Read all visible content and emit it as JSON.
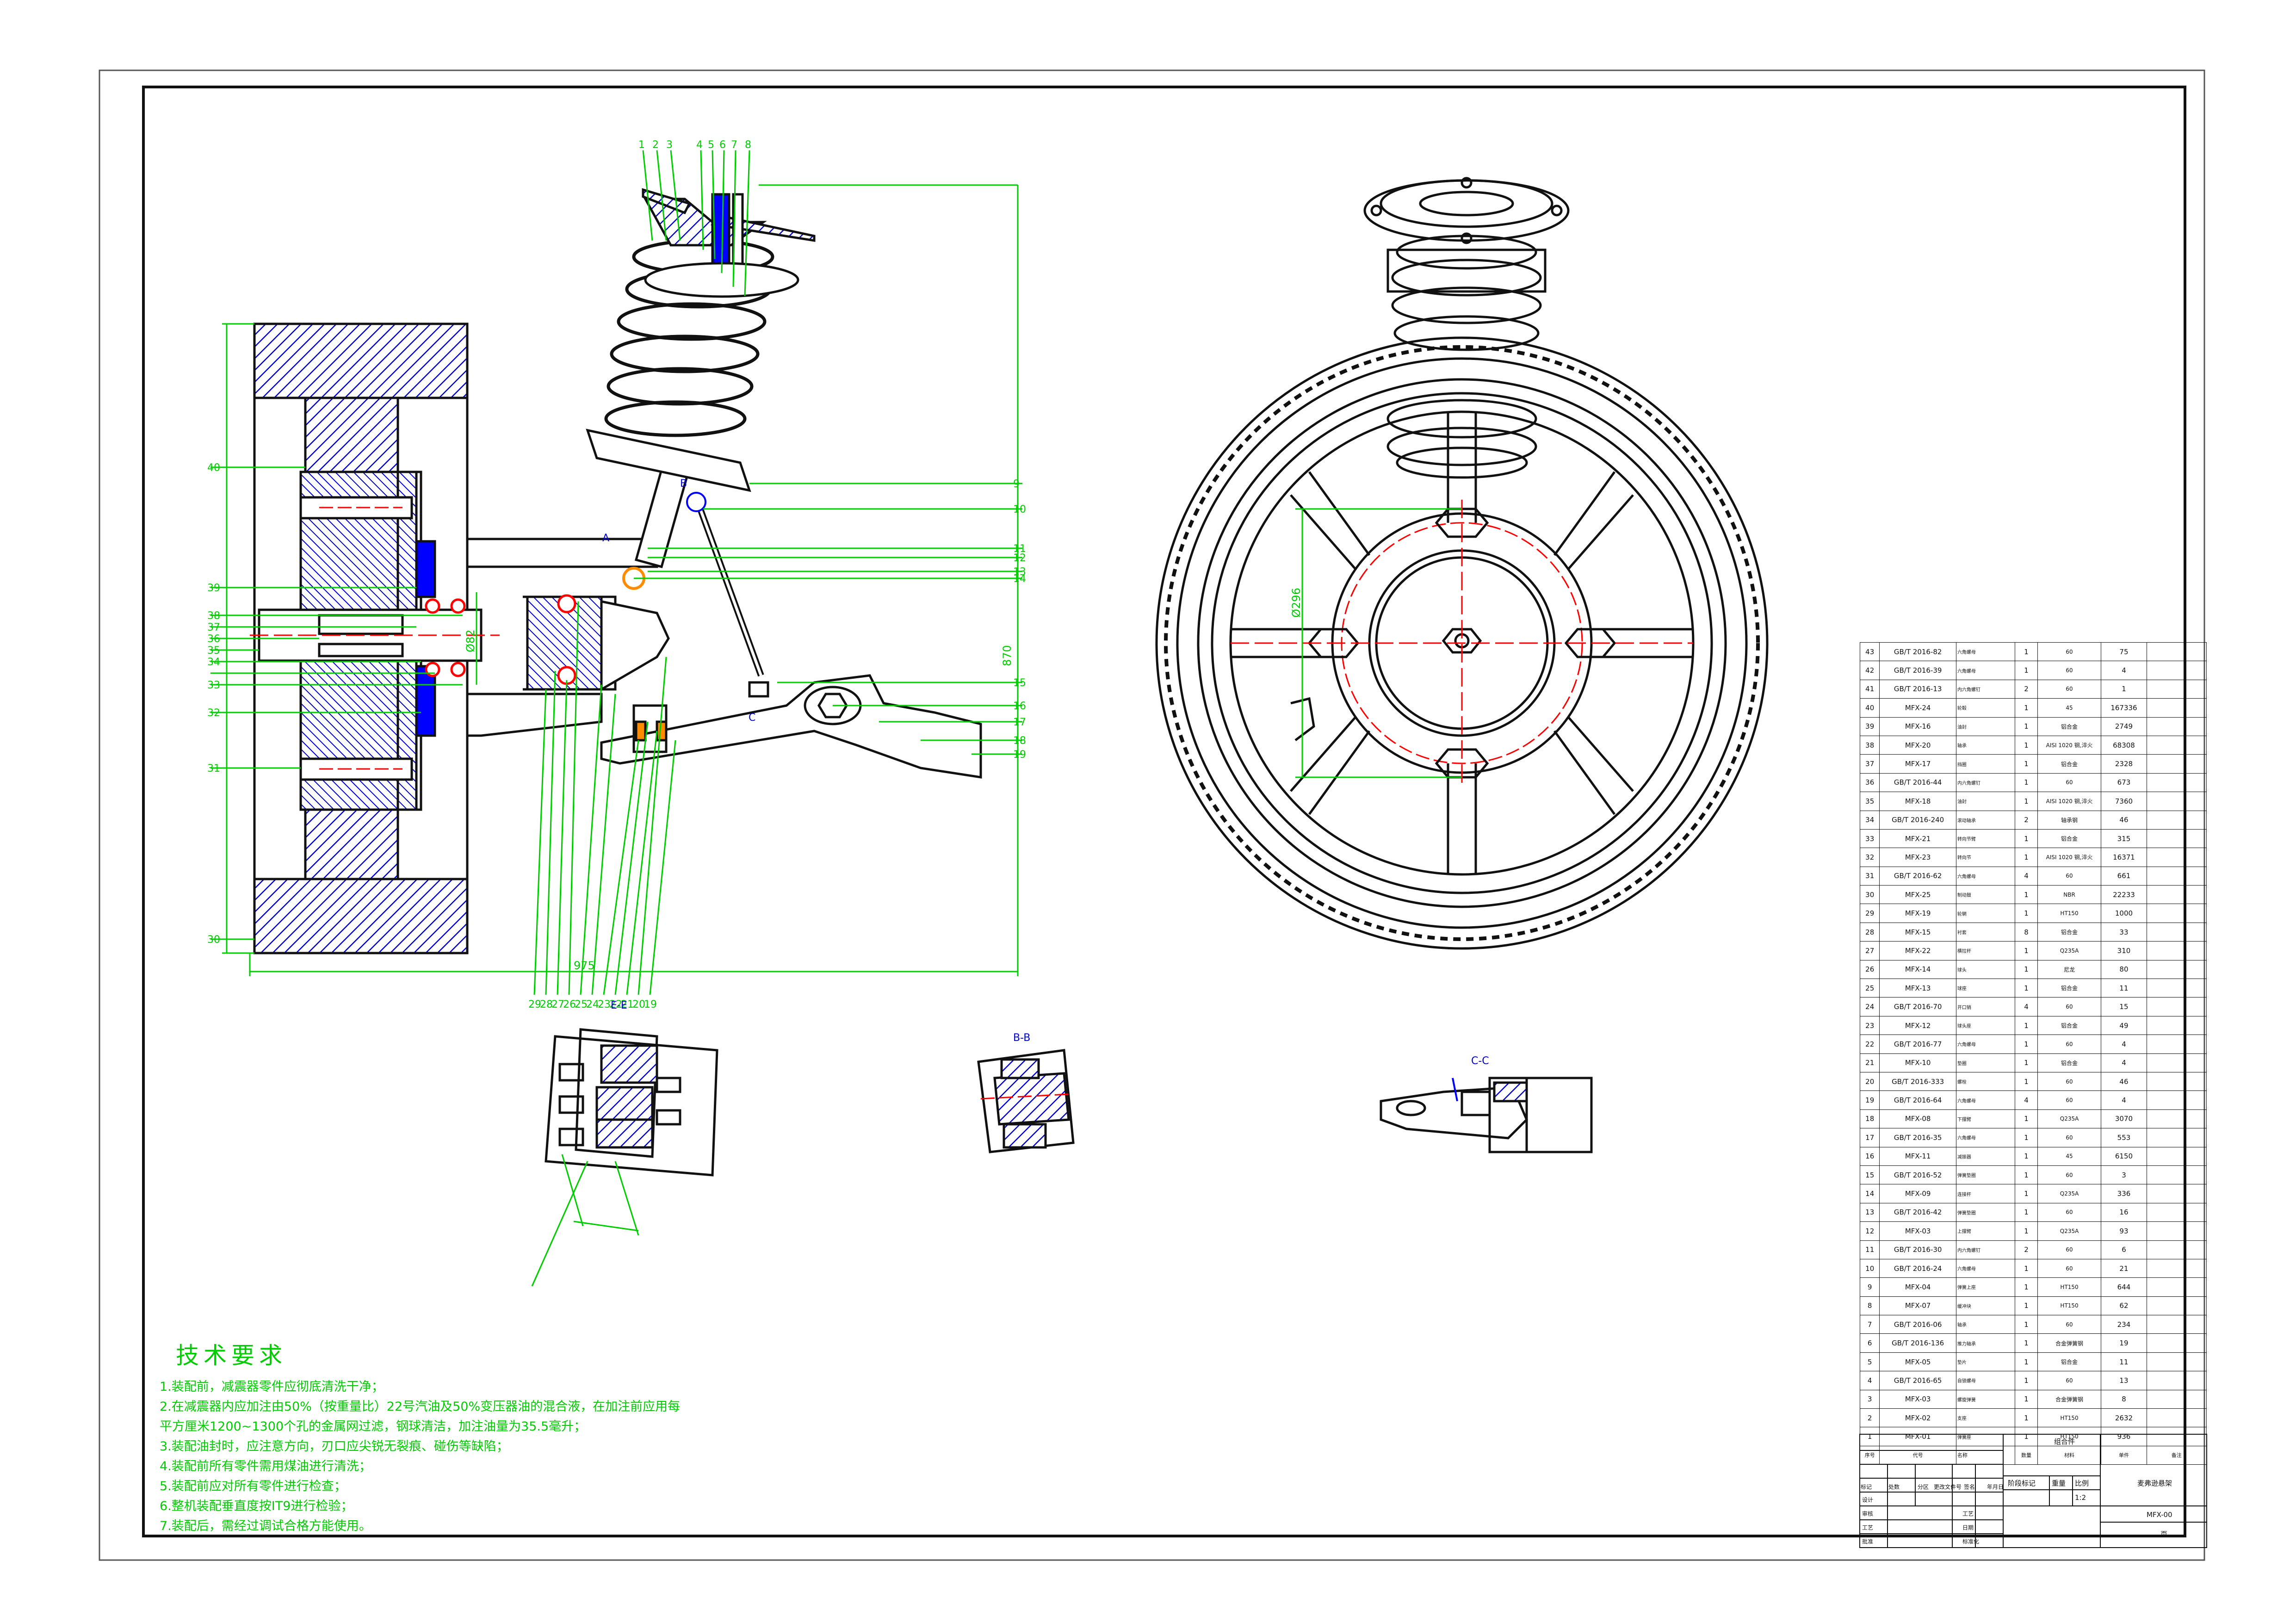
{
  "colors": {
    "outline": "#111111",
    "hatch": "#0000cc",
    "dimension": "#00cc00",
    "centerline": "#ff0000",
    "seal": "#0000ff",
    "weld": "#ff8c00"
  },
  "balloons_top": [
    "1",
    "2",
    "3",
    "4",
    "5",
    "6",
    "7",
    "8"
  ],
  "balloons_left": [
    "40",
    "39",
    "38",
    "37",
    "36",
    "35",
    "34",
    "33",
    "32",
    "31",
    "30"
  ],
  "balloons_right": [
    "9",
    "10",
    "11",
    "12",
    "13",
    "14",
    "15",
    "16",
    "17",
    "18",
    "19"
  ],
  "balloons_bottom": [
    "29",
    "28",
    "27",
    "26",
    "25",
    "24",
    "23",
    "22",
    "21",
    "20",
    "19"
  ],
  "view_labels": {
    "a": "A",
    "b": "B",
    "c": "C",
    "section_b": "B-B",
    "section_c": "C-C",
    "section_e": "E-E"
  },
  "dimensions": {
    "width": "975",
    "height": "870",
    "bore": "Ø82",
    "pcd": "Ø296"
  },
  "technical_requirements": {
    "title": "技术要求",
    "lines": [
      "1.装配前，减震器零件应彻底清洗干净；",
      "2.在减震器内应加注由50%（按重量比）22号汽油及50%变压器油的混合液，在加注前应用每",
      "平方厘米1200~1300个孔的金属网过滤，钢球清洁，加注油量为35.5毫升；",
      "3.装配油封时，应注意方向，刃口应尖锐无裂痕、碰伤等缺陷；",
      "4.装配前所有零件需用煤油进行清洗；",
      "5.装配前应对所有零件进行检查；",
      "6.整机装配垂直度按IT9进行检验；",
      "7.装配后，需经过调试合格方能使用。"
    ]
  },
  "bom": {
    "rows": [
      [
        "43",
        "GB/T 2016-82",
        "六角螺母",
        "1",
        "60",
        "75",
        ""
      ],
      [
        "42",
        "GB/T 2016-39",
        "六角螺母",
        "1",
        "60",
        "4",
        ""
      ],
      [
        "41",
        "GB/T 2016-13",
        "内六角螺钉",
        "2",
        "60",
        "1",
        ""
      ],
      [
        "40",
        "MFX-24",
        "轮毂",
        "1",
        "45",
        "167336",
        ""
      ],
      [
        "39",
        "MFX-16",
        "油封",
        "1",
        "铝合金",
        "2749",
        ""
      ],
      [
        "38",
        "MFX-20",
        "轴承",
        "1",
        "AISI 1020 钢,淬火",
        "68308",
        ""
      ],
      [
        "37",
        "MFX-17",
        "挡圈",
        "1",
        "铝合金",
        "2328",
        ""
      ],
      [
        "36",
        "GB/T 2016-44",
        "内六角螺钉",
        "1",
        "60",
        "673",
        ""
      ],
      [
        "35",
        "MFX-18",
        "油封",
        "1",
        "AISI 1020 钢,淬火",
        "7360",
        ""
      ],
      [
        "34",
        "GB/T 2016-240",
        "滚动轴承",
        "2",
        "轴承钢",
        "46",
        ""
      ],
      [
        "33",
        "MFX-21",
        "转向节臂",
        "1",
        "铝合金",
        "315",
        ""
      ],
      [
        "32",
        "MFX-23",
        "转向节",
        "1",
        "AISI 1020 钢,淬火",
        "16371",
        ""
      ],
      [
        "31",
        "GB/T 2016-62",
        "六角螺母",
        "4",
        "60",
        "661",
        ""
      ],
      [
        "30",
        "MFX-25",
        "制动鼓",
        "1",
        "NBR",
        "22233",
        ""
      ],
      [
        "29",
        "MFX-19",
        "轮辋",
        "1",
        "HT150",
        "1000",
        ""
      ],
      [
        "28",
        "MFX-15",
        "衬套",
        "8",
        "铝合金",
        "33",
        ""
      ],
      [
        "27",
        "MFX-22",
        "横拉杆",
        "1",
        "Q235A",
        "310",
        ""
      ],
      [
        "26",
        "MFX-14",
        "球头",
        "1",
        "尼龙",
        "80",
        ""
      ],
      [
        "25",
        "MFX-13",
        "球座",
        "1",
        "铝合金",
        "11",
        ""
      ],
      [
        "24",
        "GB/T 2016-70",
        "开口销",
        "4",
        "60",
        "15",
        ""
      ],
      [
        "23",
        "MFX-12",
        "球头座",
        "1",
        "铝合金",
        "49",
        ""
      ],
      [
        "22",
        "GB/T 2016-77",
        "六角螺母",
        "1",
        "60",
        "4",
        ""
      ],
      [
        "21",
        "MFX-10",
        "垫圈",
        "1",
        "铝合金",
        "4",
        ""
      ],
      [
        "20",
        "GB/T 2016-333",
        "螺栓",
        "1",
        "60",
        "46",
        ""
      ],
      [
        "19",
        "GB/T 2016-64",
        "六角螺母",
        "4",
        "60",
        "4",
        ""
      ],
      [
        "18",
        "MFX-08",
        "下摆臂",
        "1",
        "Q235A",
        "3070",
        ""
      ],
      [
        "17",
        "GB/T 2016-35",
        "六角螺母",
        "1",
        "60",
        "553",
        ""
      ],
      [
        "16",
        "MFX-11",
        "减振器",
        "1",
        "45",
        "6150",
        ""
      ],
      [
        "15",
        "GB/T 2016-52",
        "弹簧垫圈",
        "1",
        "60",
        "3",
        ""
      ],
      [
        "14",
        "MFX-09",
        "连接杆",
        "1",
        "Q235A",
        "336",
        ""
      ],
      [
        "13",
        "GB/T 2016-42",
        "弹簧垫圈",
        "1",
        "60",
        "16",
        ""
      ],
      [
        "12",
        "MFX-03",
        "上摆臂",
        "1",
        "Q235A",
        "93",
        ""
      ],
      [
        "11",
        "GB/T 2016-30",
        "内六角螺钉",
        "2",
        "60",
        "6",
        ""
      ],
      [
        "10",
        "GB/T 2016-24",
        "六角螺母",
        "1",
        "60",
        "21",
        ""
      ],
      [
        "9",
        "MFX-04",
        "弹簧上座",
        "1",
        "HT150",
        "644",
        ""
      ],
      [
        "8",
        "MFX-07",
        "缓冲块",
        "1",
        "HT150",
        "62",
        ""
      ],
      [
        "7",
        "GB/T 2016-06",
        "轴承",
        "1",
        "60",
        "234",
        ""
      ],
      [
        "6",
        "GB/T 2016-136",
        "推力轴承",
        "1",
        "合金弹簧钢",
        "19",
        ""
      ],
      [
        "5",
        "MFX-05",
        "垫片",
        "1",
        "铝合金",
        "11",
        ""
      ],
      [
        "4",
        "GB/T 2016-65",
        "自锁螺母",
        "1",
        "60",
        "13",
        ""
      ],
      [
        "3",
        "MFX-03",
        "螺旋弹簧",
        "1",
        "合金弹簧钢",
        "8",
        ""
      ],
      [
        "2",
        "MFX-02",
        "支座",
        "1",
        "HT150",
        "2632",
        ""
      ],
      [
        "1",
        "MFX-01",
        "弹簧座",
        "1",
        "HT150",
        "936",
        ""
      ]
    ],
    "header": [
      "序号",
      "代号",
      "名称",
      "数量",
      "材料",
      "单件",
      "备注"
    ]
  },
  "title_block": {
    "assembly_label": "组合件",
    "stage_label": "阶段标记",
    "weight_label": "重量",
    "scale_label": "比例",
    "scale": "1:2",
    "drawing_name": "麦弗逊悬架",
    "drawing_code": "MFX-00",
    "sheet": "页",
    "rows": [
      "标记",
      "处数",
      "分区",
      "更改文件号",
      "签名",
      "年月日"
    ],
    "roles": [
      "设计",
      "审核",
      "工艺",
      "批准"
    ],
    "process": [
      "工艺",
      "日期",
      "标准化"
    ]
  }
}
